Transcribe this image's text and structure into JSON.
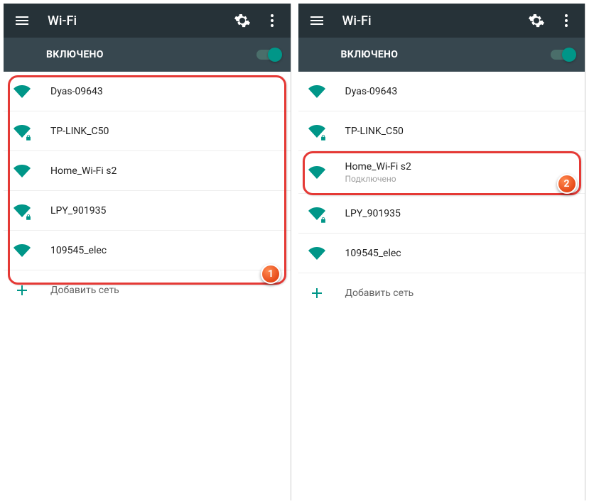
{
  "left": {
    "appbar": {
      "title": "Wi-Fi"
    },
    "toggle": {
      "label": "ВКЛЮЧЕНО"
    },
    "networks": [
      {
        "name": "Dyas-09643",
        "secured": false
      },
      {
        "name": "TP-LINK_C50",
        "secured": true
      },
      {
        "name": "Home_Wi-Fi s2",
        "secured": false
      },
      {
        "name": "LPY_901935",
        "secured": true
      },
      {
        "name": "109545_elec",
        "secured": false
      }
    ],
    "add_label": "Добавить сеть",
    "annotation_badge": "1"
  },
  "right": {
    "appbar": {
      "title": "Wi-Fi"
    },
    "toggle": {
      "label": "ВКЛЮЧЕНО"
    },
    "networks": [
      {
        "name": "Dyas-09643",
        "secured": false,
        "sub": null
      },
      {
        "name": "TP-LINK_C50",
        "secured": true,
        "sub": null
      },
      {
        "name": "Home_Wi-Fi s2",
        "secured": false,
        "sub": "Подключено"
      },
      {
        "name": "LPY_901935",
        "secured": true,
        "sub": null
      },
      {
        "name": "109545_elec",
        "secured": false,
        "sub": null
      }
    ],
    "add_label": "Добавить сеть",
    "annotation_badge": "2"
  }
}
